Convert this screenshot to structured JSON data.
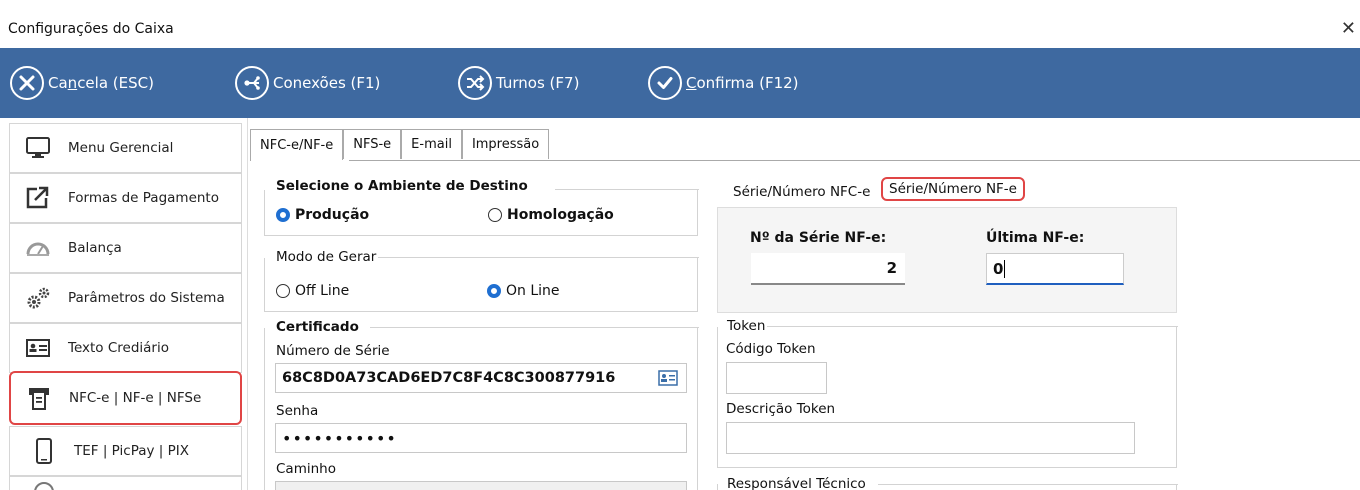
{
  "window": {
    "title": "Configurações do Caixa",
    "close_glyph": "✕"
  },
  "toolbar": {
    "cancel": {
      "prefix": "Ca",
      "underline": "n",
      "suffix": "cela (ESC)"
    },
    "connections": "Conexões (F1)",
    "shifts": "Turnos (F7)",
    "confirm": {
      "underline": "C",
      "suffix": "onfirma (F12)"
    },
    "bg_color": "#3e69a0"
  },
  "sidebar": {
    "items": [
      {
        "label": "Menu Gerencial",
        "icon": "monitor-icon"
      },
      {
        "label": "Formas de Pagamento",
        "icon": "external-link-icon"
      },
      {
        "label": "Balança",
        "icon": "gauge-icon"
      },
      {
        "label": "Parâmetros do Sistema",
        "icon": "gears-icon"
      },
      {
        "label": "Texto Crediário",
        "icon": "id-card-icon"
      },
      {
        "label": "NFC-e | NF-e | NFSe",
        "icon": "receipt-printer-icon",
        "selected": true
      },
      {
        "label": "TEF | PicPay | PIX",
        "icon": "smartphone-icon"
      }
    ]
  },
  "tabs": [
    "NFC-e/NF-e",
    "NFS-e",
    "E-mail",
    "Impressão"
  ],
  "ambiente": {
    "legend": "Selecione o Ambiente de Destino",
    "options": [
      "Produção",
      "Homologação"
    ],
    "selected": "Produção"
  },
  "modo": {
    "legend": "Modo de Gerar",
    "options": [
      "Off Line",
      "On Line"
    ],
    "selected": "On Line"
  },
  "certificado": {
    "legend": "Certificado",
    "serial_label": "Número de Série",
    "serial_value": "68C8D0A73CAD6ED7C8F4C8C300877916",
    "password_label": "Senha",
    "password_value": "•••••••••••",
    "path_label": "Caminho"
  },
  "serie_tabs": [
    "Série/Número NFC-e",
    "Série/Número NF-e"
  ],
  "serie": {
    "serie_label": "Nº da Série NF-e:",
    "serie_value": "2",
    "ultima_label": "Última NF-e:",
    "ultima_value": "0"
  },
  "token": {
    "legend": "Token",
    "code_label": "Código Token",
    "code_value": "",
    "desc_label": "Descrição Token",
    "desc_value": ""
  },
  "responsavel": {
    "legend": "Responsável Técnico"
  },
  "colors": {
    "selection_outline": "#e04545",
    "radio_on": "#1f6fd1"
  }
}
